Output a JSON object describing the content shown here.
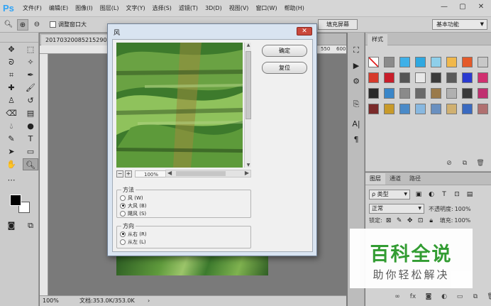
{
  "app": {
    "logo": "Ps"
  },
  "menu": [
    "文件(F)",
    "编辑(E)",
    "图像(I)",
    "图层(L)",
    "文字(Y)",
    "选择(S)",
    "滤镜(T)",
    "3D(D)",
    "视图(V)",
    "窗口(W)",
    "帮助(H)"
  ],
  "window_controls": {
    "minimize": "—",
    "maximize": "▢",
    "close": "✕"
  },
  "options_bar": {
    "resize_windows_label": "调整窗口大",
    "fill_screen_label": "填充屏幕",
    "workspace": "基本功能"
  },
  "document": {
    "tab_title": "20170320085215290",
    "ruler_numbers": [
      "500",
      "550",
      "600"
    ],
    "zoom": "100%",
    "doc_info": "文档:353.0K/353.0K",
    "status_arrow": "›"
  },
  "styles_panel": {
    "title": "样式",
    "swatches": [
      "#ffffff",
      "#8a8a8a",
      "#3fb0e8",
      "#2fa8e0",
      "#8ecfea",
      "#f0b84c",
      "#e45a2a",
      "#c8c8c8",
      "#d63a2c",
      "#c81e2a",
      "#555555",
      "#e8e8e8",
      "#3a3a3a",
      "#5a5a5a",
      "#2a3ad0",
      "#d03070",
      "#2a2a2a",
      "#3a86c8",
      "#8a8a8a",
      "#6a6a6a",
      "#9a7a4a",
      "#b0b0b0",
      "#3a3a3a",
      "#c03070",
      "#7a2a2a",
      "#c89a2a",
      "#4a8ac8",
      "#88b8e0",
      "#6a90c0",
      "#d0b070",
      "#3a6ac0",
      "#b07070"
    ]
  },
  "layers_panel": {
    "tabs": [
      "图层",
      "通道",
      "路径"
    ],
    "filter_kind": "ρ 类型",
    "blend_mode": "正常",
    "opacity_label": "不透明度:",
    "opacity_value": "100%",
    "lock_label": "锁定:",
    "fill_label": "填充:",
    "fill_value": "100%"
  },
  "watermark": {
    "title": "百科全说",
    "subtitle": "助你轻松解决"
  },
  "dialog": {
    "title": "风",
    "close_glyph": "✕",
    "ok_label": "确定",
    "reset_label": "复位",
    "zoom_minus": "−",
    "zoom_plus": "+",
    "zoom_value": "100%",
    "method": {
      "legend": "方法",
      "options": [
        "风 (W)",
        "大风 (B)",
        "飓风 (S)"
      ],
      "selected_index": 1
    },
    "direction": {
      "legend": "方向",
      "options": [
        "从右 (R)",
        "从左 (L)"
      ],
      "selected_index": 0
    }
  }
}
